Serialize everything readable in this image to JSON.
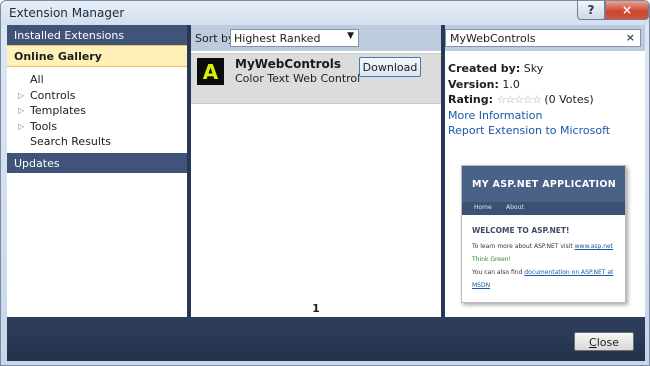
{
  "window": {
    "title": "Extension Manager",
    "help_label": "?",
    "close_label": "×"
  },
  "nav": {
    "installed": "Installed Extensions",
    "gallery": "Online Gallery",
    "items": [
      {
        "label": "All",
        "expander": ""
      },
      {
        "label": "Controls",
        "expander": "▷"
      },
      {
        "label": "Templates",
        "expander": "▷"
      },
      {
        "label": "Tools",
        "expander": "▷"
      },
      {
        "label": "Search Results",
        "expander": ""
      }
    ],
    "updates": "Updates"
  },
  "sort": {
    "label": "Sort by:",
    "selected": "Highest Ranked"
  },
  "extension": {
    "icon_letter": "A",
    "name": "MyWebControls",
    "description": "Color Text Web Control",
    "download_label": "Download"
  },
  "page_number": "1",
  "search": {
    "value": "MyWebControls",
    "clear_label": "×"
  },
  "details": {
    "created_by_label": "Created by:",
    "created_by": "Sky",
    "version_label": "Version:",
    "version": "1.0",
    "rating_label": "Rating:",
    "rating_stars": "☆☆☆☆☆",
    "rating_votes": "(0 Votes)",
    "more_info": "More Information",
    "report": "Report Extension to Microsoft"
  },
  "preview": {
    "header": "MY ASP.NET APPLICATION",
    "menu": [
      "Home",
      "About"
    ],
    "welcome": "WELCOME TO ASP.NET!",
    "line1_text": "To learn more about ASP.NET visit",
    "line1_link": "www.asp.net",
    "line2": "Think Green!",
    "line3_text": "You can also find",
    "line3_link": "documentation on ASP.NET at MSDN"
  },
  "footer": {
    "close_label": "Close",
    "close_mnemonic": "C",
    "close_rest": "lose"
  }
}
